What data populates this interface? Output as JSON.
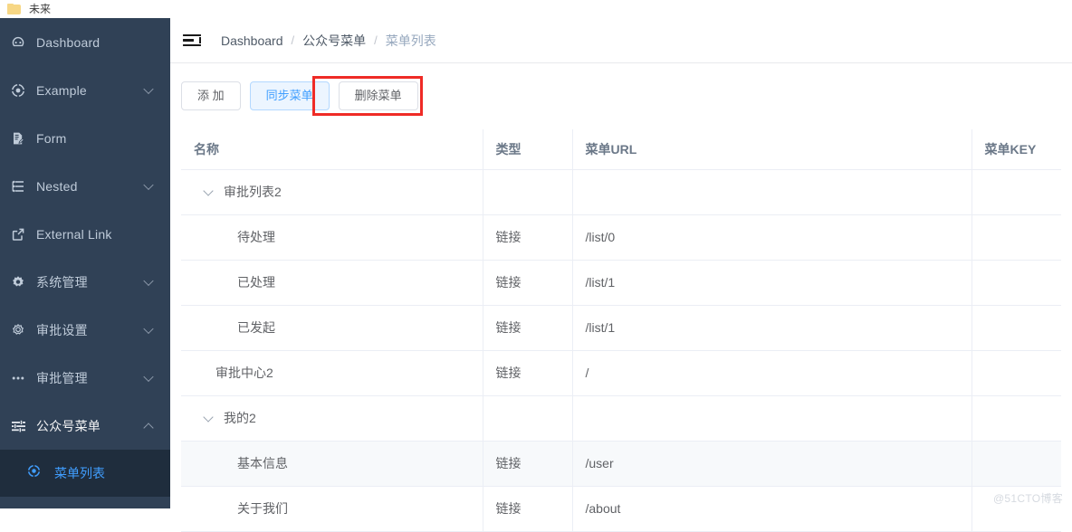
{
  "browser": {
    "bookmark_label": "未来",
    "folder_icon": "folder-icon",
    "folder_color": "#f7d785"
  },
  "theme": {
    "sidebar_bg": "#304156",
    "sidebar_active_bg": "#1f2d3d",
    "accent": "#409EFF",
    "text_muted": "#bfcbd9",
    "annotation_red": "#EF2B26",
    "table_border": "#EBEEF5",
    "row_stripe": "#F7F9FB"
  },
  "sidebar": {
    "items": [
      {
        "label": "Dashboard",
        "icon": "dashboard-icon",
        "arrow": "none",
        "active": false
      },
      {
        "label": "Example",
        "icon": "component-icon",
        "arrow": "down",
        "active": false
      },
      {
        "label": "Form",
        "icon": "form-icon",
        "arrow": "none",
        "active": false
      },
      {
        "label": "Nested",
        "icon": "nested-list-icon",
        "arrow": "down",
        "active": false
      },
      {
        "label": "External Link",
        "icon": "external-link-icon",
        "arrow": "none",
        "active": false
      },
      {
        "label": "系统管理",
        "icon": "gear-filled-icon",
        "arrow": "down",
        "active": false
      },
      {
        "label": "审批设置",
        "icon": "gear-outline-icon",
        "arrow": "down",
        "active": false
      },
      {
        "label": "审批管理",
        "icon": "ellipsis-icon",
        "arrow": "down",
        "active": false
      },
      {
        "label": "公众号菜单",
        "icon": "sliders-icon",
        "arrow": "up",
        "active": true
      }
    ],
    "sub_item": {
      "label": "菜单列表",
      "icon": "component-icon",
      "active": true
    }
  },
  "navbar": {
    "hamburger_icon": "hamburger-collapse-icon",
    "breadcrumb": [
      {
        "label": "Dashboard",
        "current": false
      },
      {
        "label": "公众号菜单",
        "current": false
      },
      {
        "label": "菜单列表",
        "current": true
      }
    ],
    "breadcrumb_separator": "/"
  },
  "toolbar": {
    "buttons": [
      {
        "label": "添 加",
        "style": "default"
      },
      {
        "label": "同步菜单",
        "style": "primary-plain"
      },
      {
        "label": "删除菜单",
        "style": "default",
        "annotated": true
      }
    ]
  },
  "table": {
    "headers": [
      "名称",
      "类型",
      "菜单URL",
      "菜单KEY"
    ],
    "rows": [
      {
        "name": "审批列表2",
        "level": 1,
        "expandable": true,
        "expanded": true,
        "type": "",
        "url": "",
        "key": "",
        "striped": false
      },
      {
        "name": "待处理",
        "level": 2,
        "expandable": false,
        "expanded": false,
        "type": "链接",
        "url": "/list/0",
        "key": "",
        "striped": false
      },
      {
        "name": "已处理",
        "level": 2,
        "expandable": false,
        "expanded": false,
        "type": "链接",
        "url": "/list/1",
        "key": "",
        "striped": false
      },
      {
        "name": "已发起",
        "level": 2,
        "expandable": false,
        "expanded": false,
        "type": "链接",
        "url": "/list/1",
        "key": "",
        "striped": false
      },
      {
        "name": "审批中心2",
        "level": 1,
        "expandable": false,
        "expanded": false,
        "type": "链接",
        "url": "/",
        "key": "",
        "striped": false
      },
      {
        "name": "我的2",
        "level": 1,
        "expandable": true,
        "expanded": true,
        "type": "",
        "url": "",
        "key": "",
        "striped": false
      },
      {
        "name": "基本信息",
        "level": 2,
        "expandable": false,
        "expanded": false,
        "type": "链接",
        "url": "/user",
        "key": "",
        "striped": true
      },
      {
        "name": "关于我们",
        "level": 2,
        "expandable": false,
        "expanded": false,
        "type": "链接",
        "url": "/about",
        "key": "",
        "striped": false
      }
    ]
  },
  "watermark": {
    "text": "@51CTO博客"
  }
}
